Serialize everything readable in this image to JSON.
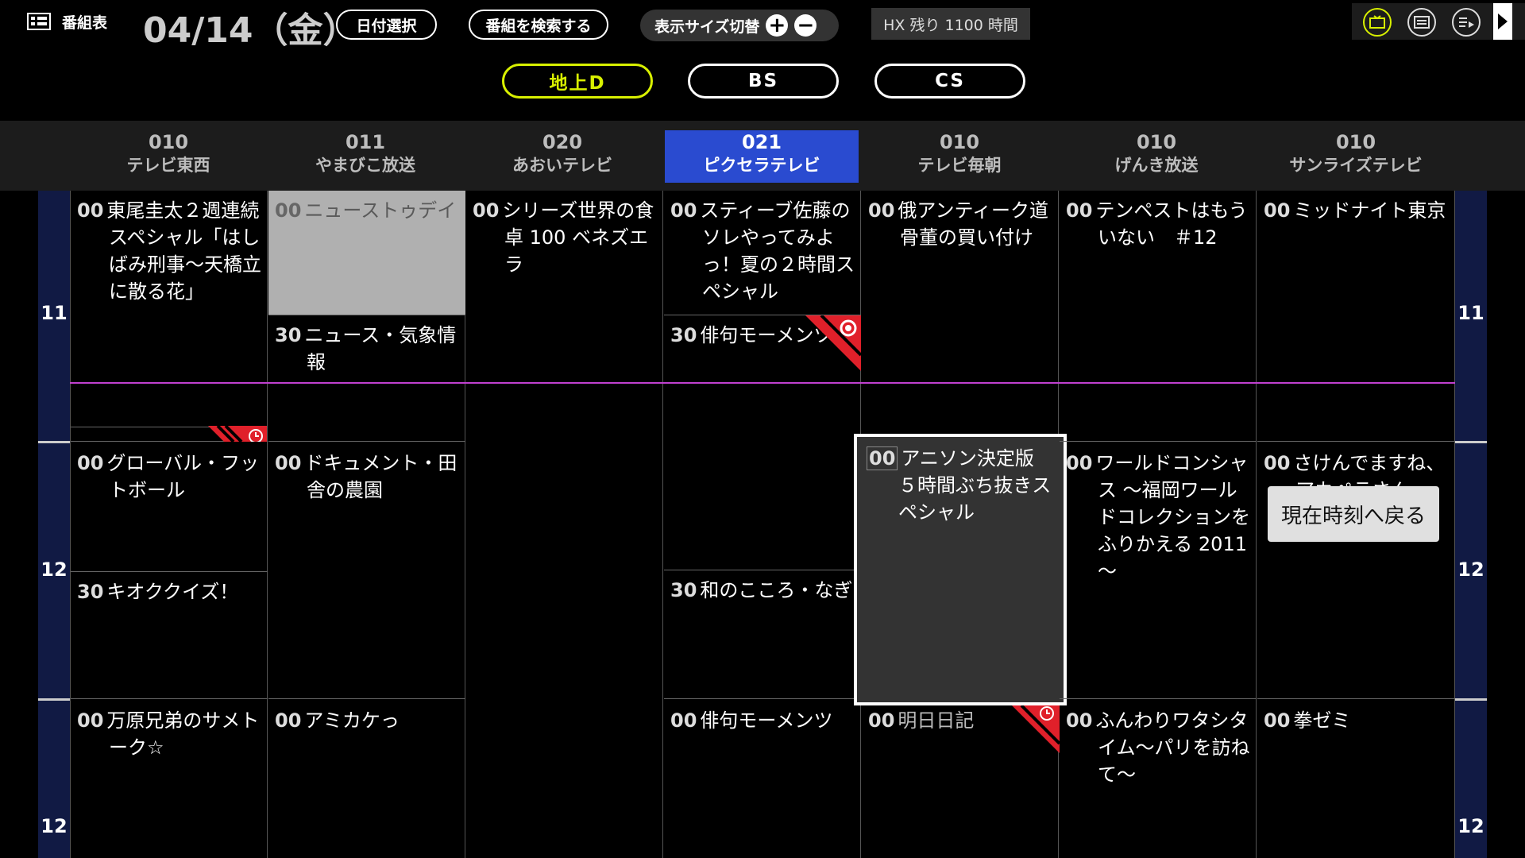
{
  "topbar": {
    "title": "番組表",
    "date": "04/14（金）",
    "date_select": "日付選択",
    "search": "番組を検索する",
    "zoom_label": "表示サイズ切替",
    "zoom_in": "+",
    "zoom_out": "−",
    "remaining": "HX 残り 1100 時間"
  },
  "networks": [
    {
      "label": "地上D",
      "active": true
    },
    {
      "label": "BS",
      "active": false
    },
    {
      "label": "CS",
      "active": false
    }
  ],
  "channels": [
    {
      "num": "010",
      "name": "テレビ東西"
    },
    {
      "num": "011",
      "name": "やまびこ放送"
    },
    {
      "num": "020",
      "name": "あおいテレビ"
    },
    {
      "num": "021",
      "name": "ピクセラテレビ"
    },
    {
      "num": "010",
      "name": "テレビ毎朝"
    },
    {
      "num": "010",
      "name": "げんき放送"
    },
    {
      "num": "010",
      "name": "サンライズテレビ"
    }
  ],
  "hours": [
    "11",
    "12",
    "12"
  ],
  "programs": {
    "c0": [
      {
        "min": "00",
        "title": "東尾圭太２週連続スペシャル「はしばみ刑事〜天橋立に散る花」"
      },
      {
        "min": "00",
        "title": "グローバル・フットボール"
      },
      {
        "min": "30",
        "title": "キオククイズ！"
      },
      {
        "min": "00",
        "title": "万原兄弟のサメトーク☆"
      }
    ],
    "c1": [
      {
        "min": "00",
        "title": "ニューストゥデイ"
      },
      {
        "min": "30",
        "title": "ニュース・気象情報"
      },
      {
        "min": "00",
        "title": "ドキュメント・田舎の農園"
      },
      {
        "min": "00",
        "title": "アミカケっ"
      }
    ],
    "c2": [
      {
        "min": "00",
        "title": "シリーズ世界の食卓 100 ベネズエラ"
      }
    ],
    "c3": [
      {
        "min": "00",
        "title": "スティーブ佐藤のソレやってみよっ！夏の２時間スペシャル"
      },
      {
        "min": "30",
        "title": "俳句モーメンツ"
      },
      {
        "min": "30",
        "title": "和のこころ・なぎ"
      },
      {
        "min": "00",
        "title": "俳句モーメンツ"
      }
    ],
    "c4": [
      {
        "min": "00",
        "title": "俄アンティーク道　骨董の買い付け"
      },
      {
        "min": "00",
        "title": "アニソン決定版　５時間ぶち抜きスペシャル"
      },
      {
        "min": "00",
        "title": "明日日記"
      }
    ],
    "c5": [
      {
        "min": "00",
        "title": "テンペストはもういない　＃12"
      },
      {
        "min": "00",
        "title": "ワールドコンシャス 〜福岡ワールドコレクションをふりかえる 2011 〜"
      },
      {
        "min": "00",
        "title": "ふんわりワタシタイム〜パリを訪ねて〜"
      }
    ],
    "c6": [
      {
        "min": "00",
        "title": "ミッドナイト東京"
      },
      {
        "min": "00",
        "title": "さけんでますね、アカペラさん"
      },
      {
        "min": "00",
        "title": "拳ゼミ"
      }
    ]
  },
  "toast": "現在時刻へ戻る",
  "colors": {
    "active_tab": "#d8f000",
    "selected_channel": "#2a4bd0",
    "now_line": "#c040d0",
    "hour_column": "#111a44",
    "reserve_mark": "#e0202a"
  },
  "icons": [
    "grid-icon",
    "tv-icon",
    "program-guide-icon",
    "playlist-icon",
    "play-arrow-icon",
    "record-icon",
    "timer-icon"
  ]
}
